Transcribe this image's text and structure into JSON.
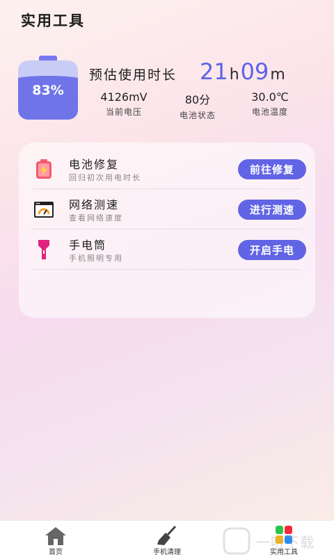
{
  "header": {
    "title": "实用工具"
  },
  "battery": {
    "level": 83,
    "percent_label": "83%",
    "estimate_label": "预估使用时长",
    "hours": "21",
    "hours_unit": "h",
    "minutes": "09",
    "minutes_unit": "m",
    "stats": [
      {
        "value": "4126mV",
        "label": "当前电压"
      },
      {
        "value": "80分",
        "label": "电池状态"
      },
      {
        "value": "30.0℃",
        "label": "电池温度"
      }
    ]
  },
  "tools": [
    {
      "title": "电池修复",
      "desc": "回归初次用电时长",
      "button": "前往修复",
      "icon": "battery-repair-icon"
    },
    {
      "title": "网络测速",
      "desc": "查看网络速度",
      "button": "进行测速",
      "icon": "speed-gauge-icon"
    },
    {
      "title": "手电筒",
      "desc": "手机照明专用",
      "button": "开启手电",
      "icon": "flashlight-icon"
    }
  ],
  "nav": [
    {
      "label": "首页",
      "icon": "home-icon"
    },
    {
      "label": "手机清理",
      "icon": "broom-icon"
    },
    {
      "label": "实用工具",
      "icon": "apps-icon"
    }
  ],
  "colors": {
    "accent": "#6164e4",
    "battery_fill": "#6f74e8",
    "battery_empty": "#c9cdf6",
    "repair_red": "#f25a6c",
    "flashlight_magenta": "#e0237d"
  },
  "watermark": {
    "text": "一听下载"
  }
}
